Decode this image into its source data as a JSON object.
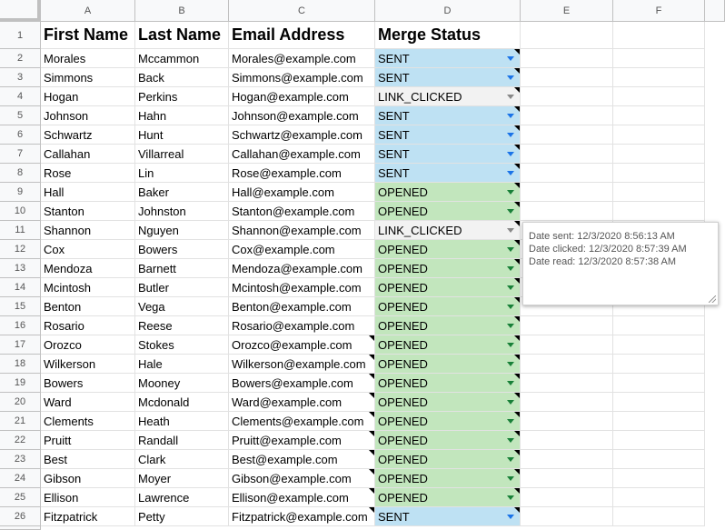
{
  "columns": [
    "A",
    "B",
    "C",
    "D",
    "E",
    "F"
  ],
  "header": [
    "First Name",
    "Last Name",
    "Email Address",
    "Merge Status"
  ],
  "rows": [
    [
      "2",
      "Morales",
      "Mccammon",
      "Morales@example.com",
      "SENT"
    ],
    [
      "3",
      "Simmons",
      "Back",
      "Simmons@example.com",
      "SENT"
    ],
    [
      "4",
      "Hogan",
      "Perkins",
      "Hogan@example.com",
      "LINK_CLICKED"
    ],
    [
      "5",
      "Johnson",
      "Hahn",
      "Johnson@example.com",
      "SENT"
    ],
    [
      "6",
      "Schwartz",
      "Hunt",
      "Schwartz@example.com",
      "SENT"
    ],
    [
      "7",
      "Callahan",
      "Villarreal",
      "Callahan@example.com",
      "SENT"
    ],
    [
      "8",
      "Rose",
      "Lin",
      "Rose@example.com",
      "SENT"
    ],
    [
      "9",
      "Hall",
      "Baker",
      "Hall@example.com",
      "OPENED"
    ],
    [
      "10",
      "Stanton",
      "Johnston",
      "Stanton@example.com",
      "OPENED"
    ],
    [
      "11",
      "Shannon",
      "Nguyen",
      "Shannon@example.com",
      "LINK_CLICKED"
    ],
    [
      "12",
      "Cox",
      "Bowers",
      "Cox@example.com",
      "OPENED"
    ],
    [
      "13",
      "Mendoza",
      "Barnett",
      "Mendoza@example.com",
      "OPENED"
    ],
    [
      "14",
      "Mcintosh",
      "Butler",
      "Mcintosh@example.com",
      "OPENED"
    ],
    [
      "15",
      "Benton",
      "Vega",
      "Benton@example.com",
      "OPENED"
    ],
    [
      "16",
      "Rosario",
      "Reese",
      "Rosario@example.com",
      "OPENED"
    ],
    [
      "17",
      "Orozco",
      "Stokes",
      "Orozco@example.com",
      "OPENED"
    ],
    [
      "18",
      "Wilkerson",
      "Hale",
      "Wilkerson@example.com",
      "OPENED"
    ],
    [
      "19",
      "Bowers",
      "Mooney",
      "Bowers@example.com",
      "OPENED"
    ],
    [
      "20",
      "Ward",
      "Mcdonald",
      "Ward@example.com",
      "OPENED"
    ],
    [
      "21",
      "Clements",
      "Heath",
      "Clements@example.com",
      "OPENED"
    ],
    [
      "22",
      "Pruitt",
      "Randall",
      "Pruitt@example.com",
      "OPENED"
    ],
    [
      "23",
      "Best",
      "Clark",
      "Best@example.com",
      "OPENED"
    ],
    [
      "24",
      "Gibson",
      "Moyer",
      "Gibson@example.com",
      "OPENED"
    ],
    [
      "25",
      "Ellison",
      "Lawrence",
      "Ellison@example.com",
      "OPENED"
    ],
    [
      "26",
      "Fitzpatrick",
      "Petty",
      "Fitzpatrick@example.com",
      "SENT"
    ]
  ],
  "note": {
    "date_sent": "Date sent:  12/3/2020 8:56:13 AM",
    "date_clicked": "Date clicked:  12/3/2020 8:57:39 AM",
    "date_read": "Date read:  12/3/2020 8:57:38 AM"
  },
  "colors": {
    "SENT": "#bee1f3",
    "OPENED": "#c2e6bd",
    "LINK_CLICKED": "#f2f2f2",
    "SENT_arrow": "#1a73e8",
    "OPENED_arrow": "#188038",
    "LINK_CLICKED_arrow": "#888888"
  }
}
